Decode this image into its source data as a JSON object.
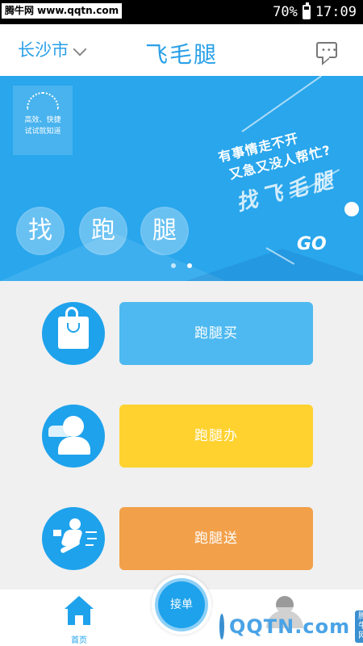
{
  "status_bar": {
    "watermark": "腾牛网 www.qqtn.com",
    "battery": "70%",
    "battery_level": 0.7,
    "time": "17:09"
  },
  "header": {
    "city": "长沙市",
    "title": "飞毛腿"
  },
  "banner": {
    "badge_line1": "高效、快捷",
    "badge_line2": "试试就知道",
    "slogan_line1": "有事情走不开",
    "slogan_line2": "又急又没人帮忙?",
    "slogan_line3": "找飞毛腿",
    "circle_chars": [
      "找",
      "跑",
      "腿"
    ],
    "go": "GO",
    "page_count": 2,
    "active_page": 1
  },
  "services": [
    {
      "label": "跑腿买",
      "color": "#4eb9f0",
      "icon": "shopping-bag-icon"
    },
    {
      "label": "跑腿办",
      "color": "#ffd230",
      "icon": "person-car-icon"
    },
    {
      "label": "跑腿送",
      "color": "#f2a04a",
      "icon": "running-courier-icon"
    }
  ],
  "bottom_nav": {
    "home_label": "首页",
    "order_label": "接单"
  },
  "watermark_br": {
    "text": "QQTN.com",
    "badge": "腾牛网"
  },
  "colors": {
    "primary": "#1ea2ec",
    "banner": "#29a6ec"
  }
}
